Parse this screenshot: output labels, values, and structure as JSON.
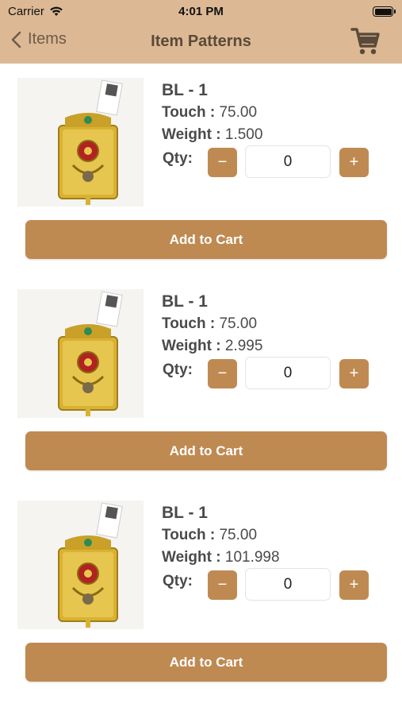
{
  "status_bar": {
    "carrier": "Carrier",
    "time": "4:01 PM"
  },
  "nav": {
    "back_label": "Items",
    "title": "Item Patterns"
  },
  "colors": {
    "accent": "#bf8a52",
    "header": "#dcb994"
  },
  "products": [
    {
      "name": "BL - 1",
      "touch_label": "Touch :",
      "touch_value": "75.00",
      "weight_label": "Weight :",
      "weight_value": "1.500",
      "qty_label": "Qty:",
      "qty": "0",
      "minus": "−",
      "plus": "+",
      "add_to_cart": "Add to Cart"
    },
    {
      "name": "BL - 1",
      "touch_label": "Touch :",
      "touch_value": "75.00",
      "weight_label": "Weight :",
      "weight_value": "2.995",
      "qty_label": "Qty:",
      "qty": "0",
      "minus": "−",
      "plus": "+",
      "add_to_cart": "Add to Cart"
    },
    {
      "name": "BL - 1",
      "touch_label": "Touch :",
      "touch_value": "75.00",
      "weight_label": "Weight :",
      "weight_value": "101.998",
      "qty_label": "Qty:",
      "qty": "0",
      "minus": "−",
      "plus": "+",
      "add_to_cart": "Add to Cart"
    }
  ]
}
